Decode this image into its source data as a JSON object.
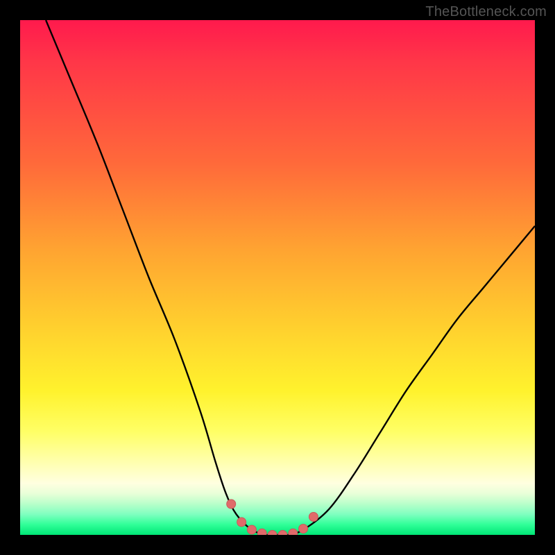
{
  "watermark": {
    "text": "TheBottleneck.com"
  },
  "colors": {
    "background": "#000000",
    "curve_stroke": "#000000",
    "marker_fill": "#e06a6a",
    "marker_stroke": "#c85a5a"
  },
  "chart_data": {
    "type": "line",
    "title": "",
    "xlabel": "",
    "ylabel": "",
    "xlim": [
      0,
      100
    ],
    "ylim": [
      0,
      100
    ],
    "grid": false,
    "legend": false,
    "series": [
      {
        "name": "bottleneck-curve",
        "x": [
          5,
          10,
          15,
          20,
          25,
          30,
          35,
          38,
          40,
          42,
          45,
          48,
          50,
          52,
          55,
          60,
          65,
          70,
          75,
          80,
          85,
          90,
          95,
          100
        ],
        "y": [
          100,
          88,
          76,
          63,
          50,
          38,
          24,
          14,
          8,
          4,
          1,
          0,
          0,
          0,
          1,
          5,
          12,
          20,
          28,
          35,
          42,
          48,
          54,
          60
        ]
      }
    ],
    "markers": {
      "name": "trough-dots",
      "x": [
        41,
        43,
        45,
        47,
        49,
        51,
        53,
        55,
        57
      ],
      "y": [
        6,
        2.5,
        1,
        0.3,
        0,
        0,
        0.3,
        1.2,
        3.5
      ]
    }
  }
}
